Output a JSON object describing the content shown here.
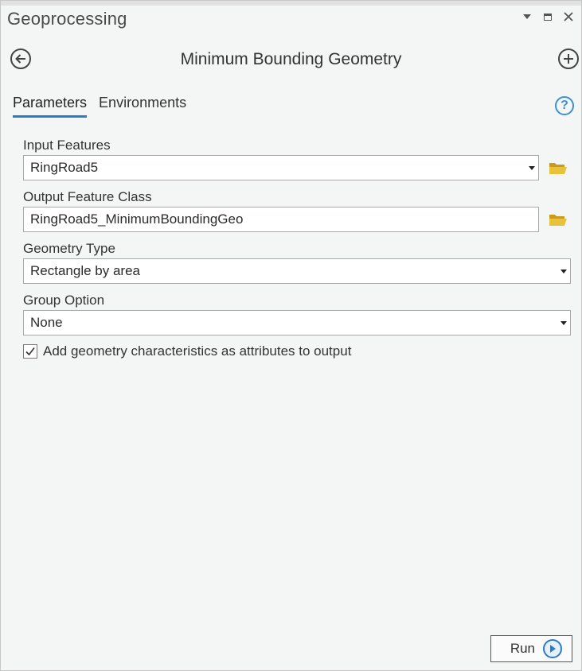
{
  "pane": {
    "title": "Geoprocessing",
    "controls": [
      "menu-dropdown-icon",
      "maximize-icon",
      "close-icon"
    ]
  },
  "tool": {
    "title": "Minimum Bounding Geometry",
    "back_icon": "back-arrow-icon",
    "add_icon": "add-plus-icon"
  },
  "tabs": {
    "parameters": "Parameters",
    "environments": "Environments",
    "active": "Parameters",
    "help_icon": "help-question-icon"
  },
  "params": {
    "input_features": {
      "label": "Input Features",
      "value": "RingRoad5"
    },
    "output_feature_class": {
      "label": "Output Feature Class",
      "value": "RingRoad5_MinimumBoundingGeo"
    },
    "geometry_type": {
      "label": "Geometry Type",
      "value": "Rectangle by area"
    },
    "group_option": {
      "label": "Group Option",
      "value": "None"
    },
    "add_characteristics": {
      "label": "Add geometry characteristics as attributes to output",
      "checked": true
    }
  },
  "actions": {
    "run_label": "Run"
  },
  "colors": {
    "accent": "#2b7cc7",
    "folder": "#e0b82f",
    "help": "#3d8fd6",
    "background": "#f4f6f5"
  }
}
